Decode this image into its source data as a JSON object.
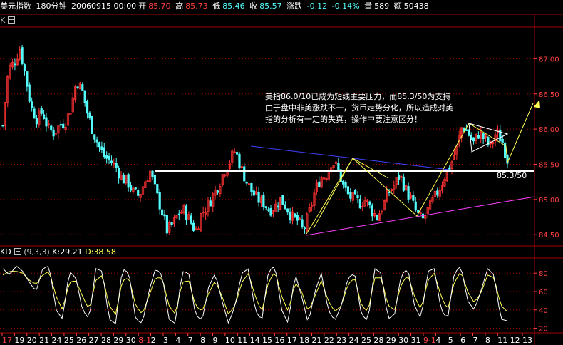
{
  "header": {
    "symbol": "美元指数",
    "period": "180分钟",
    "datetime": "20060915 00:00",
    "open_label": "开",
    "open": "85.70",
    "high_label": "高",
    "high": "85.73",
    "low_label": "低",
    "low": "85.46",
    "close_label": "收",
    "close": "85.57",
    "change_label": "涨跌",
    "change": "-0.12",
    "change_pct": "-0.14%",
    "volume_label": "量",
    "volume": "589",
    "amount_label": "额",
    "amount": "50438"
  },
  "main_panel": {
    "label": "K"
  },
  "annotation": {
    "lines": [
      "美指86.0/10已成为短线主要压力，而85.3/50为支持",
      "由于盘中非美涨跌不一，货币走势分化，所以造成对美",
      "指的分析有一定的失真，操作中要注意区分！"
    ]
  },
  "support_label": "85.3/50",
  "kdj": {
    "name": "KD",
    "params": "(9,3,3)",
    "k_label": "K:",
    "k": "29.21",
    "d_label": "D:",
    "d": "38.58"
  },
  "colors": {
    "up": "#ff3232",
    "down": "#54fcfc",
    "kline": "#ffffff",
    "dline": "#ffff54",
    "grid": "#a00000"
  },
  "chart_data": {
    "type": "candlestick",
    "y_ticks": [
      "87.00",
      "86.50",
      "86.00",
      "85.50",
      "85.00",
      "84.50"
    ],
    "ylim": [
      84.36,
      87.45
    ],
    "kd_ticks": [
      "80",
      "60",
      "40",
      "20"
    ],
    "kd_lim": [
      15,
      98
    ],
    "x_ticks": [
      "17",
      "19",
      "20",
      "21",
      "24",
      "25",
      "26",
      "27",
      "28",
      "29",
      "30",
      "8-1",
      "2",
      "3",
      "4",
      "7",
      "8",
      "9",
      "10",
      "11",
      "14",
      "15",
      "16",
      "17",
      "18",
      "21",
      "22",
      "23",
      "24",
      "25",
      "28",
      "29",
      "30",
      "31",
      "9-1",
      "4",
      "5",
      "6",
      "7",
      "8",
      "11",
      "12",
      "13"
    ],
    "x_tick_colors": [
      "#ff4040",
      "#ffffff",
      "#ffffff",
      "#ffffff",
      "#ffffff",
      "#ffffff",
      "#ffffff",
      "#ffffff",
      "#ffffff",
      "#ffffff",
      "#ffffff",
      "#ff4040",
      "#ffffff",
      "#ffffff",
      "#ffffff",
      "#ffffff",
      "#ffffff",
      "#ffffff",
      "#ffffff",
      "#ffffff",
      "#ffffff",
      "#ffffff",
      "#ffffff",
      "#ffffff",
      "#ffffff",
      "#ffffff",
      "#ffffff",
      "#ffffff",
      "#ffffff",
      "#ffffff",
      "#ffffff",
      "#ffffff",
      "#ffffff",
      "#ffffff",
      "#ff4040",
      "#ffffff",
      "#ffffff",
      "#ffffff",
      "#ffffff",
      "#ffffff",
      "#ffffff",
      "#ffffff",
      "#ffffff"
    ],
    "close_path": [
      86.05,
      86.85,
      86.95,
      87.15,
      86.75,
      86.3,
      86.15,
      86.25,
      86.0,
      85.95,
      86.05,
      86.1,
      86.3,
      86.7,
      86.55,
      86.2,
      85.95,
      85.75,
      85.6,
      85.55,
      85.45,
      85.3,
      85.25,
      85.1,
      85.05,
      85.25,
      85.4,
      85.1,
      84.85,
      84.55,
      84.65,
      84.8,
      84.85,
      84.7,
      84.55,
      84.8,
      84.9,
      85.05,
      85.2,
      85.4,
      85.55,
      85.7,
      85.45,
      85.25,
      85.1,
      85.0,
      84.95,
      84.85,
      84.9,
      85.0,
      84.9,
      84.75,
      84.7,
      84.55,
      84.8,
      85.1,
      85.3,
      85.35,
      85.55,
      85.45,
      85.2,
      85.05,
      85.0,
      84.95,
      85.0,
      84.85,
      84.75,
      84.9,
      85.1,
      85.2,
      85.35,
      85.15,
      85.0,
      84.8,
      84.7,
      84.85,
      85.0,
      85.15,
      85.35,
      85.5,
      85.7,
      86.05,
      85.95,
      85.8,
      85.95,
      85.85,
      85.75,
      85.95,
      85.85,
      85.57
    ],
    "k_path": [
      85,
      78,
      88,
      82,
      70,
      60,
      85,
      88,
      40,
      30,
      82,
      75,
      40,
      30,
      85,
      82,
      30,
      25,
      85,
      80,
      30,
      25,
      60,
      85,
      78,
      30,
      25,
      82,
      80,
      35,
      28,
      65,
      80,
      50,
      25,
      45,
      80,
      85,
      40,
      28,
      82,
      88,
      40,
      25,
      80,
      55,
      25,
      60,
      80,
      40,
      28,
      45,
      75,
      80,
      35,
      28,
      85,
      80,
      30,
      35,
      78,
      85,
      45,
      30,
      82,
      85,
      40,
      30,
      80,
      88,
      50,
      40,
      60,
      85,
      78,
      30,
      28
    ],
    "d_path": [
      78,
      82,
      82,
      80,
      72,
      68,
      78,
      82,
      55,
      40,
      70,
      72,
      55,
      40,
      72,
      78,
      45,
      35,
      72,
      75,
      45,
      35,
      55,
      75,
      75,
      45,
      35,
      70,
      72,
      45,
      38,
      58,
      72,
      55,
      35,
      45,
      70,
      80,
      55,
      38,
      70,
      82,
      55,
      38,
      70,
      60,
      38,
      55,
      72,
      50,
      38,
      45,
      68,
      75,
      45,
      38,
      75,
      75,
      45,
      40,
      68,
      78,
      55,
      40,
      72,
      80,
      55,
      40,
      70,
      82,
      60,
      48,
      58,
      78,
      75,
      45,
      38
    ]
  }
}
